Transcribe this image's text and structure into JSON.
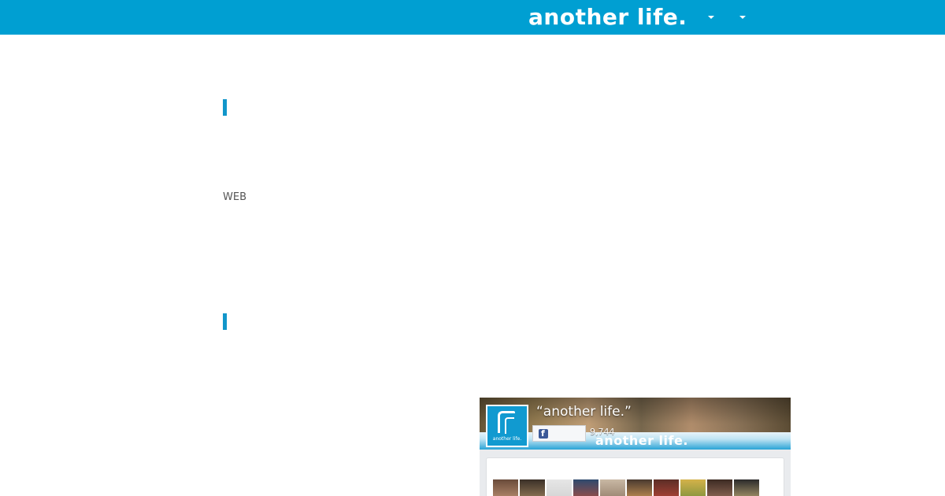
{
  "header": {
    "logo_text": "another life.",
    "nav_dropdowns": [
      "caret-down",
      "caret-down"
    ],
    "background_color": "#009fd2"
  },
  "content": {
    "section_accent_color": "#1196ca",
    "web_label": "WEB"
  },
  "facebook_widget": {
    "page_name": "“another life.”",
    "cover_wordmark": "another life.",
    "avatar_caption": "another life.",
    "like_icon": "facebook-f-icon",
    "like_count": "9,744",
    "faces_count": 10
  }
}
